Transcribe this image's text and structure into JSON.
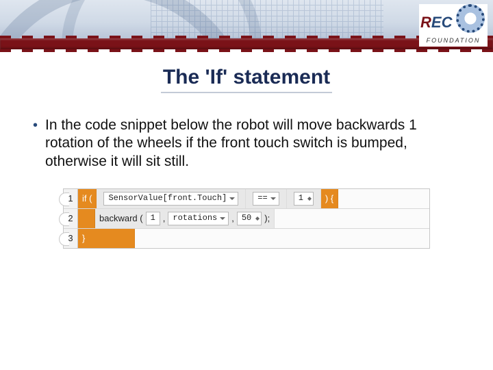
{
  "logo": {
    "r": "R",
    "ec": "EC",
    "sub": "FOUNDATION"
  },
  "title": "The 'If' statement",
  "bullet": "In the code snippet below the robot will move backwards 1 rotation of the wheels if the front touch switch is bumped, otherwise it will sit still.",
  "code": {
    "lines": [
      "1",
      "2",
      "3"
    ],
    "row1": {
      "if_open": "if (",
      "sensor": "SensorValue[front.Touch]",
      "op": "==",
      "val": "1",
      "if_close": ") {"
    },
    "row2": {
      "fn": "backward (",
      "arg1": "1",
      "comma1": ",",
      "arg2": "rotations",
      "comma2": ",",
      "arg3": "50",
      "close": ");"
    },
    "row3": {
      "brace": "}"
    }
  }
}
